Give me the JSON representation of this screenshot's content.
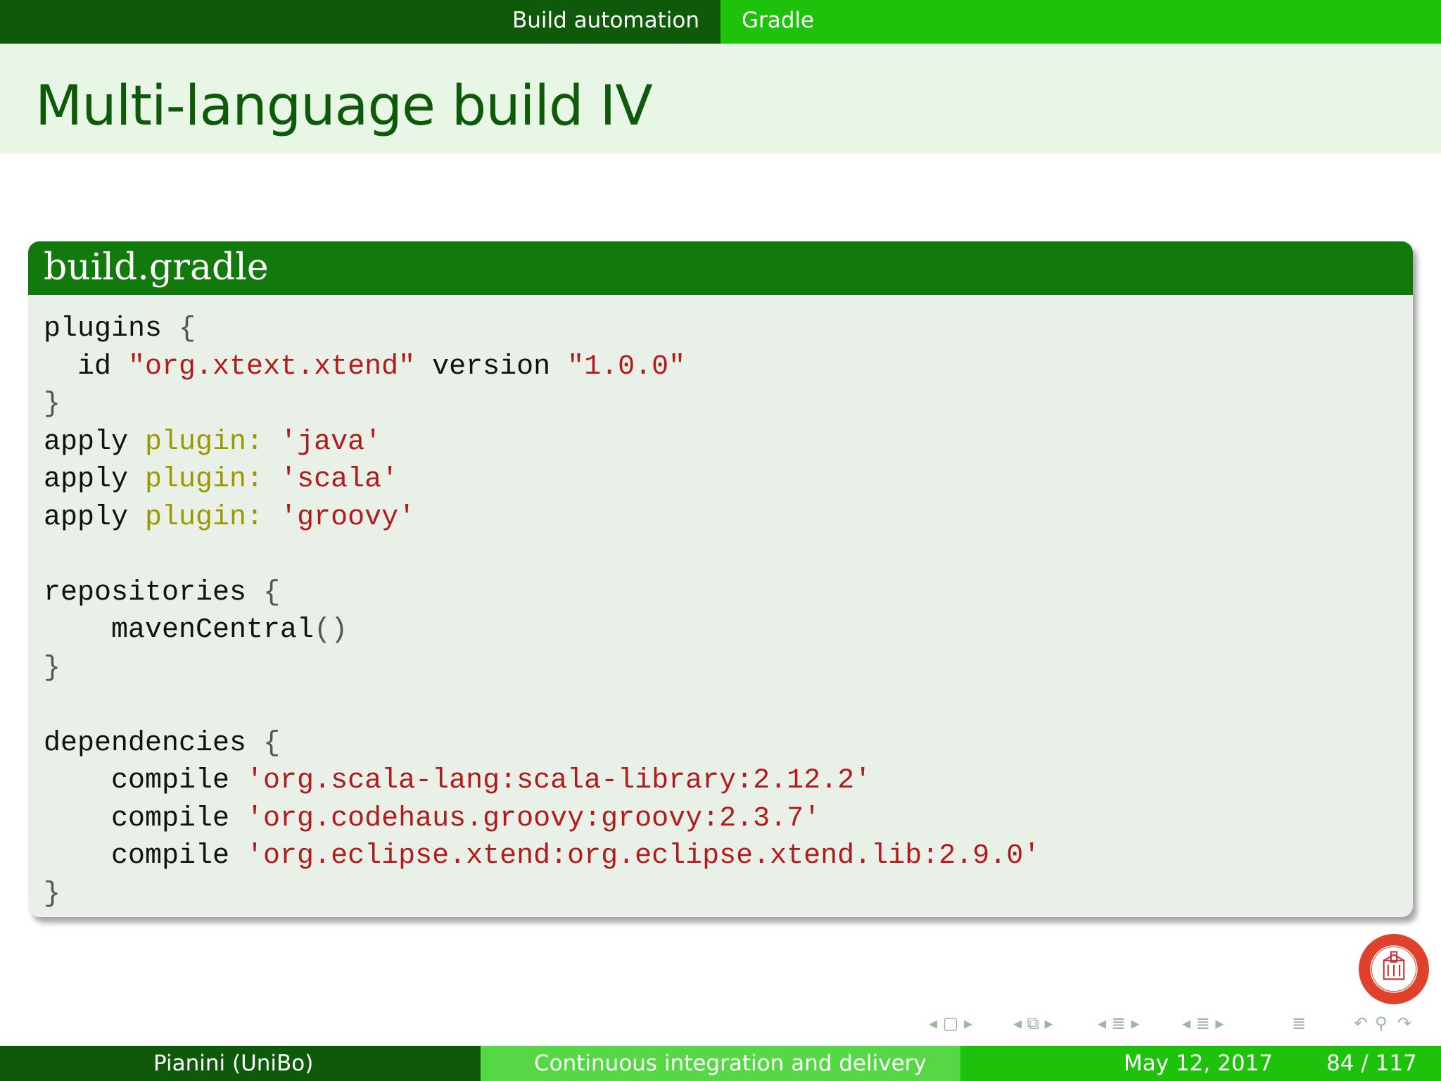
{
  "header": {
    "section": "Build automation",
    "subsection": "Gradle"
  },
  "slide": {
    "title": "Multi-language build IV"
  },
  "code_block": {
    "title": "build.gradle",
    "lines": [
      [
        {
          "t": "plugins "
        },
        {
          "t": "{",
          "c": "punc"
        }
      ],
      [
        {
          "t": "  id "
        },
        {
          "t": "\"org.xtext.xtend\"",
          "c": "str"
        },
        {
          "t": " version "
        },
        {
          "t": "\"1.0.0\"",
          "c": "str"
        }
      ],
      [
        {
          "t": "}",
          "c": "punc"
        }
      ],
      [
        {
          "t": "apply "
        },
        {
          "t": "plugin:",
          "c": "key"
        },
        {
          "t": " "
        },
        {
          "t": "'java'",
          "c": "str"
        }
      ],
      [
        {
          "t": "apply "
        },
        {
          "t": "plugin:",
          "c": "key"
        },
        {
          "t": " "
        },
        {
          "t": "'scala'",
          "c": "str"
        }
      ],
      [
        {
          "t": "apply "
        },
        {
          "t": "plugin:",
          "c": "key"
        },
        {
          "t": " "
        },
        {
          "t": "'groovy'",
          "c": "str"
        }
      ],
      [],
      [
        {
          "t": "repositories "
        },
        {
          "t": "{",
          "c": "punc"
        }
      ],
      [
        {
          "t": "    mavenCentral"
        },
        {
          "t": "()",
          "c": "punc"
        }
      ],
      [
        {
          "t": "}",
          "c": "punc"
        }
      ],
      [],
      [
        {
          "t": "dependencies "
        },
        {
          "t": "{",
          "c": "punc"
        }
      ],
      [
        {
          "t": "    compile "
        },
        {
          "t": "'org.scala-lang:scala-library:2.12.2'",
          "c": "str"
        }
      ],
      [
        {
          "t": "    compile "
        },
        {
          "t": "'org.codehaus.groovy:groovy:2.3.7'",
          "c": "str"
        }
      ],
      [
        {
          "t": "    compile "
        },
        {
          "t": "'org.eclipse.xtend:org.eclipse.xtend.lib:2.9.0'",
          "c": "str"
        }
      ],
      [
        {
          "t": "}",
          "c": "punc"
        }
      ]
    ]
  },
  "footer": {
    "author": "Pianini  (UniBo)",
    "talk_title": "Continuous integration and delivery",
    "date": "May 12, 2017",
    "page": "84 / 117"
  },
  "colors": {
    "dark_green": "#0e5a0a",
    "bright_green": "#1fc20a",
    "block_header": "#127a0c",
    "string": "#b11b1b",
    "keyword": "#9a9a00"
  },
  "icons": [
    "university-seal-logo",
    "nav-frame-icon",
    "nav-subsection-icon",
    "nav-section-icon",
    "nav-document-icon",
    "undo-icon",
    "search-icon",
    "redo-icon"
  ]
}
